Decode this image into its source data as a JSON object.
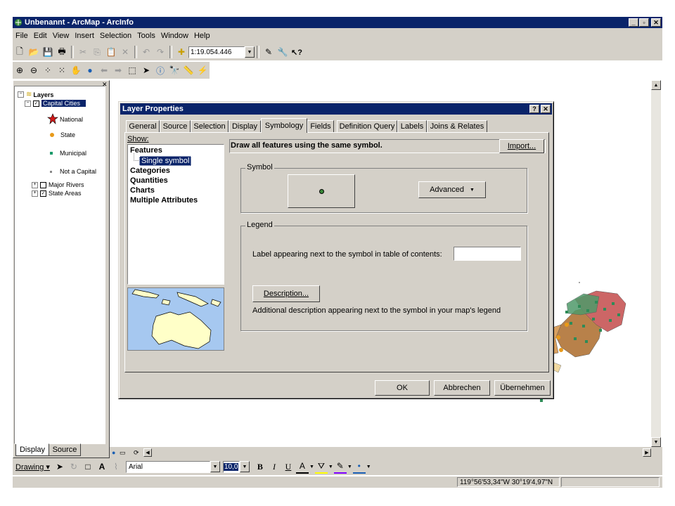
{
  "app": {
    "title": "Unbenannt - ArcMap - ArcInfo"
  },
  "menu": [
    "File",
    "Edit",
    "View",
    "Insert",
    "Selection",
    "Tools",
    "Window",
    "Help"
  ],
  "toolbar": {
    "scale_value": "1:19.054.446"
  },
  "toc": {
    "root_label": "Layers",
    "layer_selected": "Capital Cities",
    "legend_items": [
      "National",
      "State",
      "Municipal",
      "Not a Capital"
    ],
    "other_layers": [
      "Major Rivers",
      "State Areas"
    ],
    "tabs": [
      "Display",
      "Source"
    ]
  },
  "dialog": {
    "title": "Layer Properties",
    "help_btn": "?",
    "close_btn": "✕",
    "tabs": [
      "General",
      "Source",
      "Selection",
      "Display",
      "Symbology",
      "Fields",
      "Definition Query",
      "Labels",
      "Joins & Relates"
    ],
    "active_tab": "Symbology",
    "show_label": "Show:",
    "show_items": [
      "Features",
      "Single symbol",
      "Categories",
      "Quantities",
      "Charts",
      "Multiple Attributes"
    ],
    "heading": "Draw all features using the same symbol.",
    "import_btn": "Import...",
    "symbol_group": "Symbol",
    "advanced_btn": "Advanced",
    "legend_group": "Legend",
    "legend_label": "Label appearing next to the symbol in table of contents:",
    "legend_value": "",
    "description_btn": "Description...",
    "description_text": "Additional description appearing next to the symbol in your map's legend",
    "ok_btn": "OK",
    "cancel_btn": "Abbrechen",
    "apply_btn": "Übernehmen"
  },
  "drawing_toolbar": {
    "drawing_label": "Drawing",
    "font_name": "Arial",
    "font_size": "10,0",
    "bold": "B",
    "italic": "I",
    "underline": "U",
    "font_color": "A"
  },
  "status": {
    "coordinates": "119°56'53,34\"W  30°19'4,97\"N"
  },
  "colors": {
    "titlebar": "#0a246a",
    "face": "#d4d0c8",
    "map_state_red": "#cc6666",
    "map_state_tan": "#b8814a",
    "map_cities_green": "#2e8b57"
  }
}
